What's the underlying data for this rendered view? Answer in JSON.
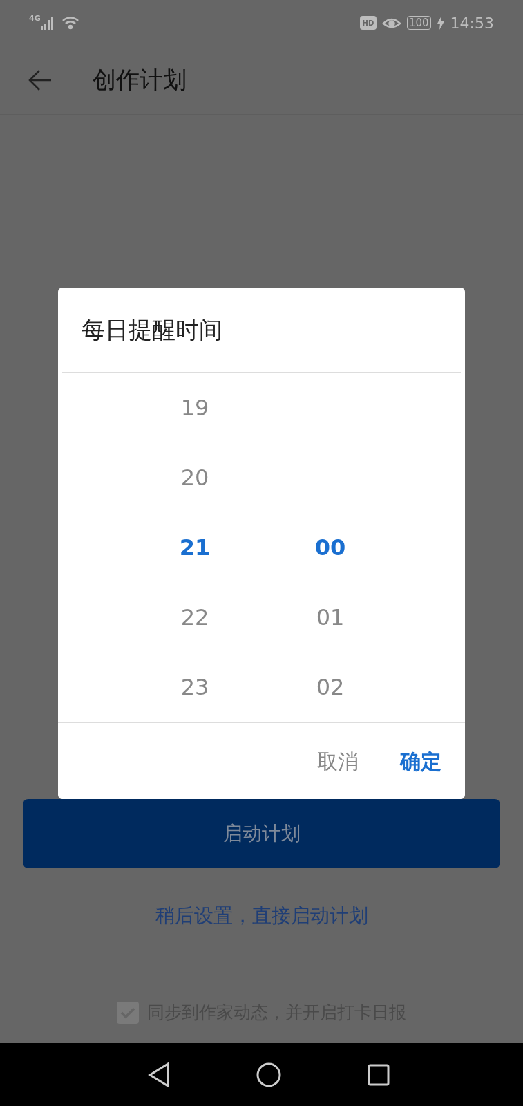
{
  "status_bar": {
    "network": "4G",
    "hd": "HD",
    "battery": "100",
    "time": "14:53"
  },
  "header": {
    "title": "创作计划"
  },
  "dialog": {
    "title": "每日提醒时间",
    "hours": [
      {
        "label": "19",
        "selected": false
      },
      {
        "label": "20",
        "selected": false
      },
      {
        "label": "21",
        "selected": true
      },
      {
        "label": "22",
        "selected": false
      },
      {
        "label": "23",
        "selected": false
      }
    ],
    "minutes": [
      {
        "label": "00",
        "selected": true
      },
      {
        "label": "01",
        "selected": false
      },
      {
        "label": "02",
        "selected": false
      }
    ],
    "buttons": [
      {
        "label": "取消",
        "kind": "cancel"
      },
      {
        "label": "确定",
        "kind": "confirm"
      }
    ]
  },
  "start_button": {
    "label": "启动计划"
  },
  "later_link": {
    "label": "稍后设置，直接启动计划"
  },
  "sync_option": {
    "label": "同步到作家动态，并开启打卡日报",
    "checked": true
  }
}
